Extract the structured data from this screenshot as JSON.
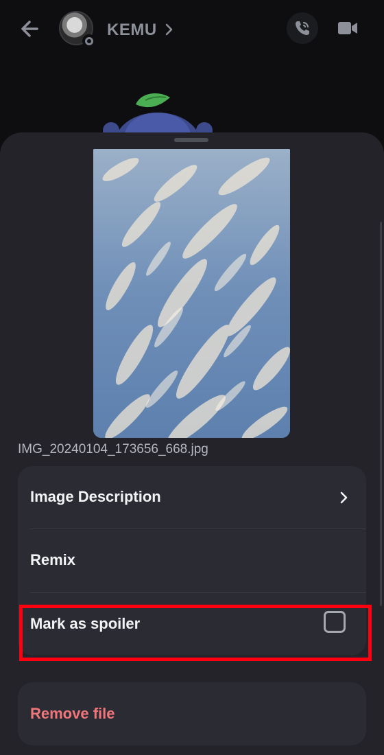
{
  "header": {
    "username": "KEMU",
    "icons": {
      "back": "arrow-left-icon",
      "chevron": "chevron-right-icon",
      "call": "phone-call-icon",
      "video": "video-camera-icon"
    }
  },
  "attachment": {
    "filename": "IMG_20240104_173656_668.jpg"
  },
  "options": {
    "image_description": "Image Description",
    "remix": "Remix",
    "mark_spoiler": "Mark as spoiler",
    "spoiler_checked": false
  },
  "remove_file": "Remove file",
  "colors": {
    "background": "#0e0e11",
    "sheet": "#232329",
    "card": "#2b2c33",
    "danger_text": "#f0767a",
    "highlight": "#ff0010"
  }
}
